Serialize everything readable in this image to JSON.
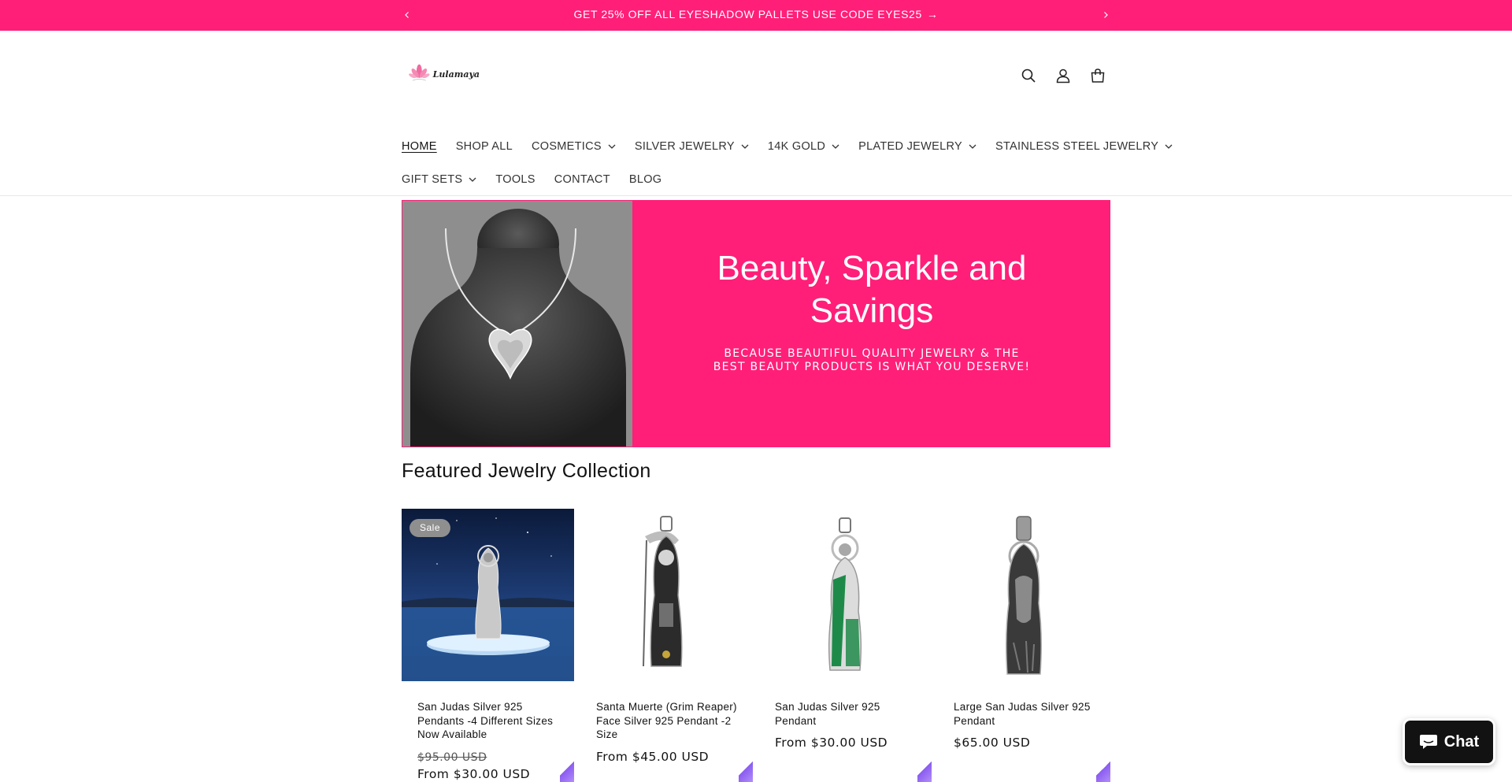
{
  "announcement": {
    "text": "GET 25% OFF ALL EYESHADOW PALLETS USE CODE EYES25",
    "arrow": "→",
    "prev_icon": "chevron-left-icon",
    "next_icon": "chevron-right-icon"
  },
  "header": {
    "logo_text": "Lulamaya",
    "icons": [
      "search-icon",
      "account-icon",
      "cart-icon"
    ]
  },
  "menu": {
    "row1": [
      {
        "label": "HOME",
        "dropdown": false,
        "active": true
      },
      {
        "label": "SHOP ALL",
        "dropdown": false
      },
      {
        "label": "COSMETICS",
        "dropdown": true
      },
      {
        "label": "SILVER JEWELRY",
        "dropdown": true
      },
      {
        "label": "14K GOLD",
        "dropdown": true
      },
      {
        "label": "PLATED JEWELRY",
        "dropdown": true
      },
      {
        "label": "STAINLESS STEEL JEWELRY",
        "dropdown": true
      }
    ],
    "row2": [
      {
        "label": "GIFT SETS",
        "dropdown": true
      },
      {
        "label": "TOOLS",
        "dropdown": false
      },
      {
        "label": "CONTACT",
        "dropdown": false
      },
      {
        "label": "BLOG",
        "dropdown": false
      }
    ]
  },
  "hero": {
    "title": "Beauty, Sparkle and Savings",
    "subtitle": "BECAUSE BEAUTIFUL QUALITY JEWELRY & THE BEST BEAUTY PRODUCTS IS WHAT YOU DESERVE!"
  },
  "featured": {
    "title": "Featured Jewelry Collection",
    "products": [
      {
        "title": "San Judas Silver 925 Pendants -4 Different Sizes Now Available",
        "badge": "Sale",
        "price_old": "$95.00 USD",
        "price": "From $30.00 USD"
      },
      {
        "title": "Santa Muerte (Grim Reaper) Face Silver 925 Pendant -2 Size",
        "price": "From $45.00 USD"
      },
      {
        "title": "San Judas Silver 925 Pendant",
        "price": "From $30.00 USD"
      },
      {
        "title": "Large San Judas Silver 925 Pendant",
        "price": "$65.00 USD"
      }
    ]
  },
  "chat": {
    "label": "Chat",
    "icon": "chat-bubble-icon"
  },
  "colors": {
    "brand_pink": "#ff1f78",
    "chat_bg": "#121212",
    "sale_badge": "#8f8f8f"
  }
}
